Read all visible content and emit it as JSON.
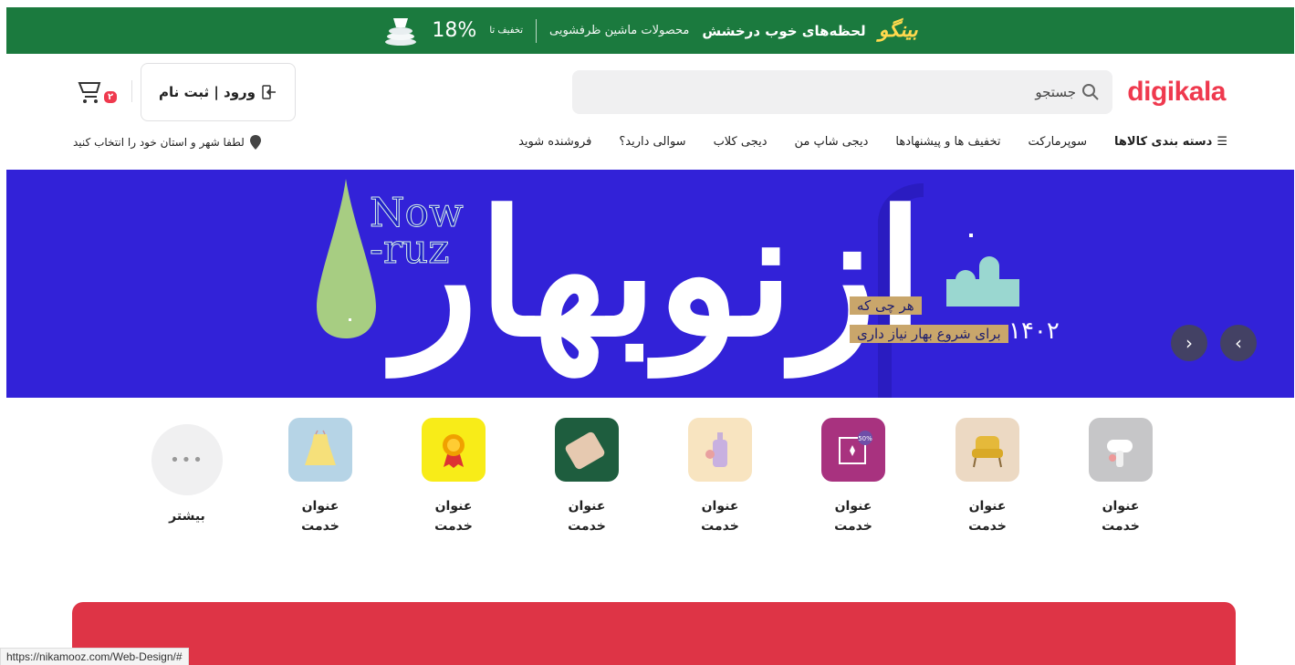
{
  "promo": {
    "brand": "بینگو",
    "headline": "لحظه‌های خوب درخشش",
    "subtitle": "محصولات ماشین ظرفشویی",
    "discount_prefix": "تخفیف تا",
    "discount_value": "18%"
  },
  "header": {
    "logo": "digikala",
    "search_placeholder": "جستجو",
    "login_label": "ورود | ثبت نام",
    "cart_count": "۲",
    "location_label": "لطفا شهر و استان خود را انتخاب کنید"
  },
  "nav": {
    "items": [
      "دسته بندی کالاها",
      "سوپرمارکت",
      "تخفیف ها و پیشنهادها",
      "دیجی شاپ من",
      "دیجی کلاب",
      "سوالی دارید؟",
      "فروشنده شوید"
    ]
  },
  "hero": {
    "headline": "ازنوبهار",
    "english": "Now\n-ruz",
    "tagline_1": "هر چی که",
    "tagline_2": "برای شروع بهار نیاز داری",
    "year": "۱۴۰۲",
    "prev_icon": "chevron-left-icon",
    "next_icon": "chevron-right-icon"
  },
  "services": {
    "items": [
      {
        "label_1": "عنوان",
        "label_2": "خدمت",
        "icon": "hair-dryer-icon"
      },
      {
        "label_1": "عنوان",
        "label_2": "خدمت",
        "icon": "armchair-icon"
      },
      {
        "label_1": "عنوان",
        "label_2": "خدمت",
        "icon": "discount-tag-icon"
      },
      {
        "label_1": "عنوان",
        "label_2": "خدمت",
        "icon": "cosmetics-icon"
      },
      {
        "label_1": "عنوان",
        "label_2": "خدمت",
        "icon": "suitcase-icon"
      },
      {
        "label_1": "عنوان",
        "label_2": "خدمت",
        "icon": "medal-icon"
      },
      {
        "label_1": "عنوان",
        "label_2": "خدمت",
        "icon": "kids-dress-icon"
      }
    ],
    "more_label": "بیشتر",
    "discount_badge": "50%"
  },
  "status_url": "https://nikamooz.com/Web-Design/#",
  "colors": {
    "promo_bg": "#1b7a3e",
    "brand_red": "#ef394e",
    "hero_bg": "#3222d8",
    "red_block": "#de3446"
  }
}
